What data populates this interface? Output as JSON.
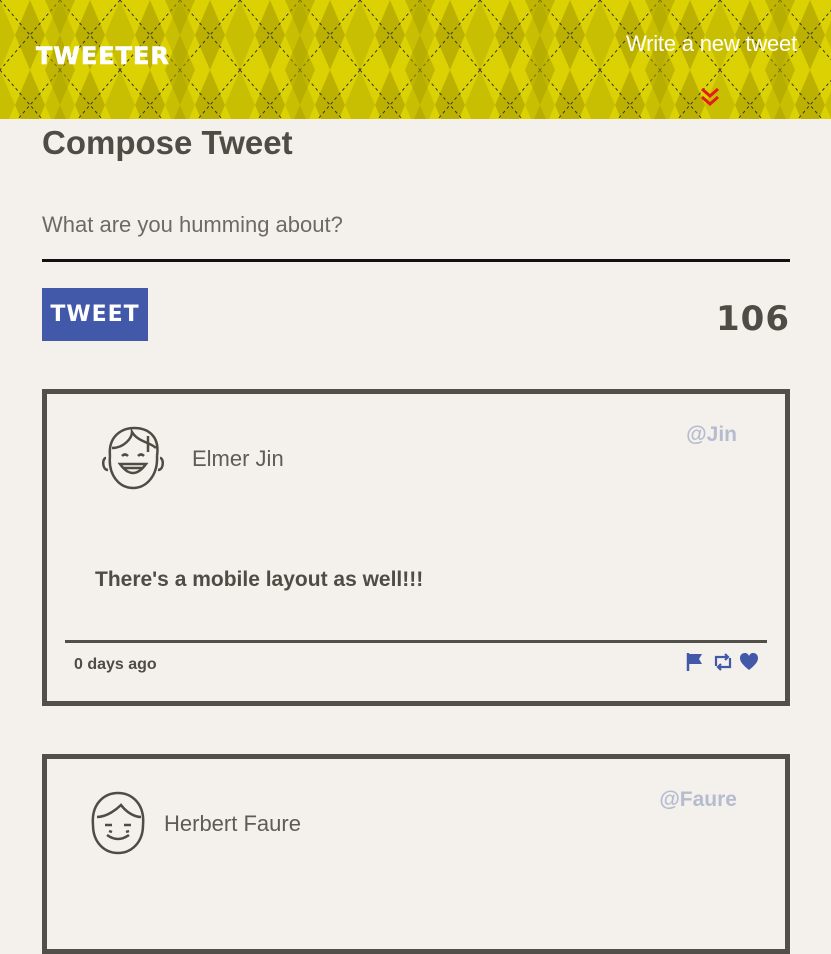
{
  "header": {
    "brand": "Tweeter",
    "write_link": "Write a new tweet",
    "chevron_icon": "double-chevron-down-icon",
    "pattern_color": "#dcd203",
    "chevron_color": "#e31b1b"
  },
  "compose": {
    "title": "Compose Tweet",
    "placeholder": "What are you humming about?",
    "button_label": "Tweet",
    "counter": "106"
  },
  "tweets": [
    {
      "name": "Elmer Jin",
      "handle": "@Jin",
      "text": "There's a mobile layout as well!!!",
      "time": "0 days ago",
      "actions": [
        "flag-icon",
        "retweet-icon",
        "heart-icon"
      ]
    },
    {
      "name": "Herbert Faure",
      "handle": "@Faure"
    }
  ],
  "colors": {
    "background": "#f4f1ec",
    "accent": "#4258a8",
    "handle": "#b6bcd0",
    "border": "#524f4a"
  }
}
